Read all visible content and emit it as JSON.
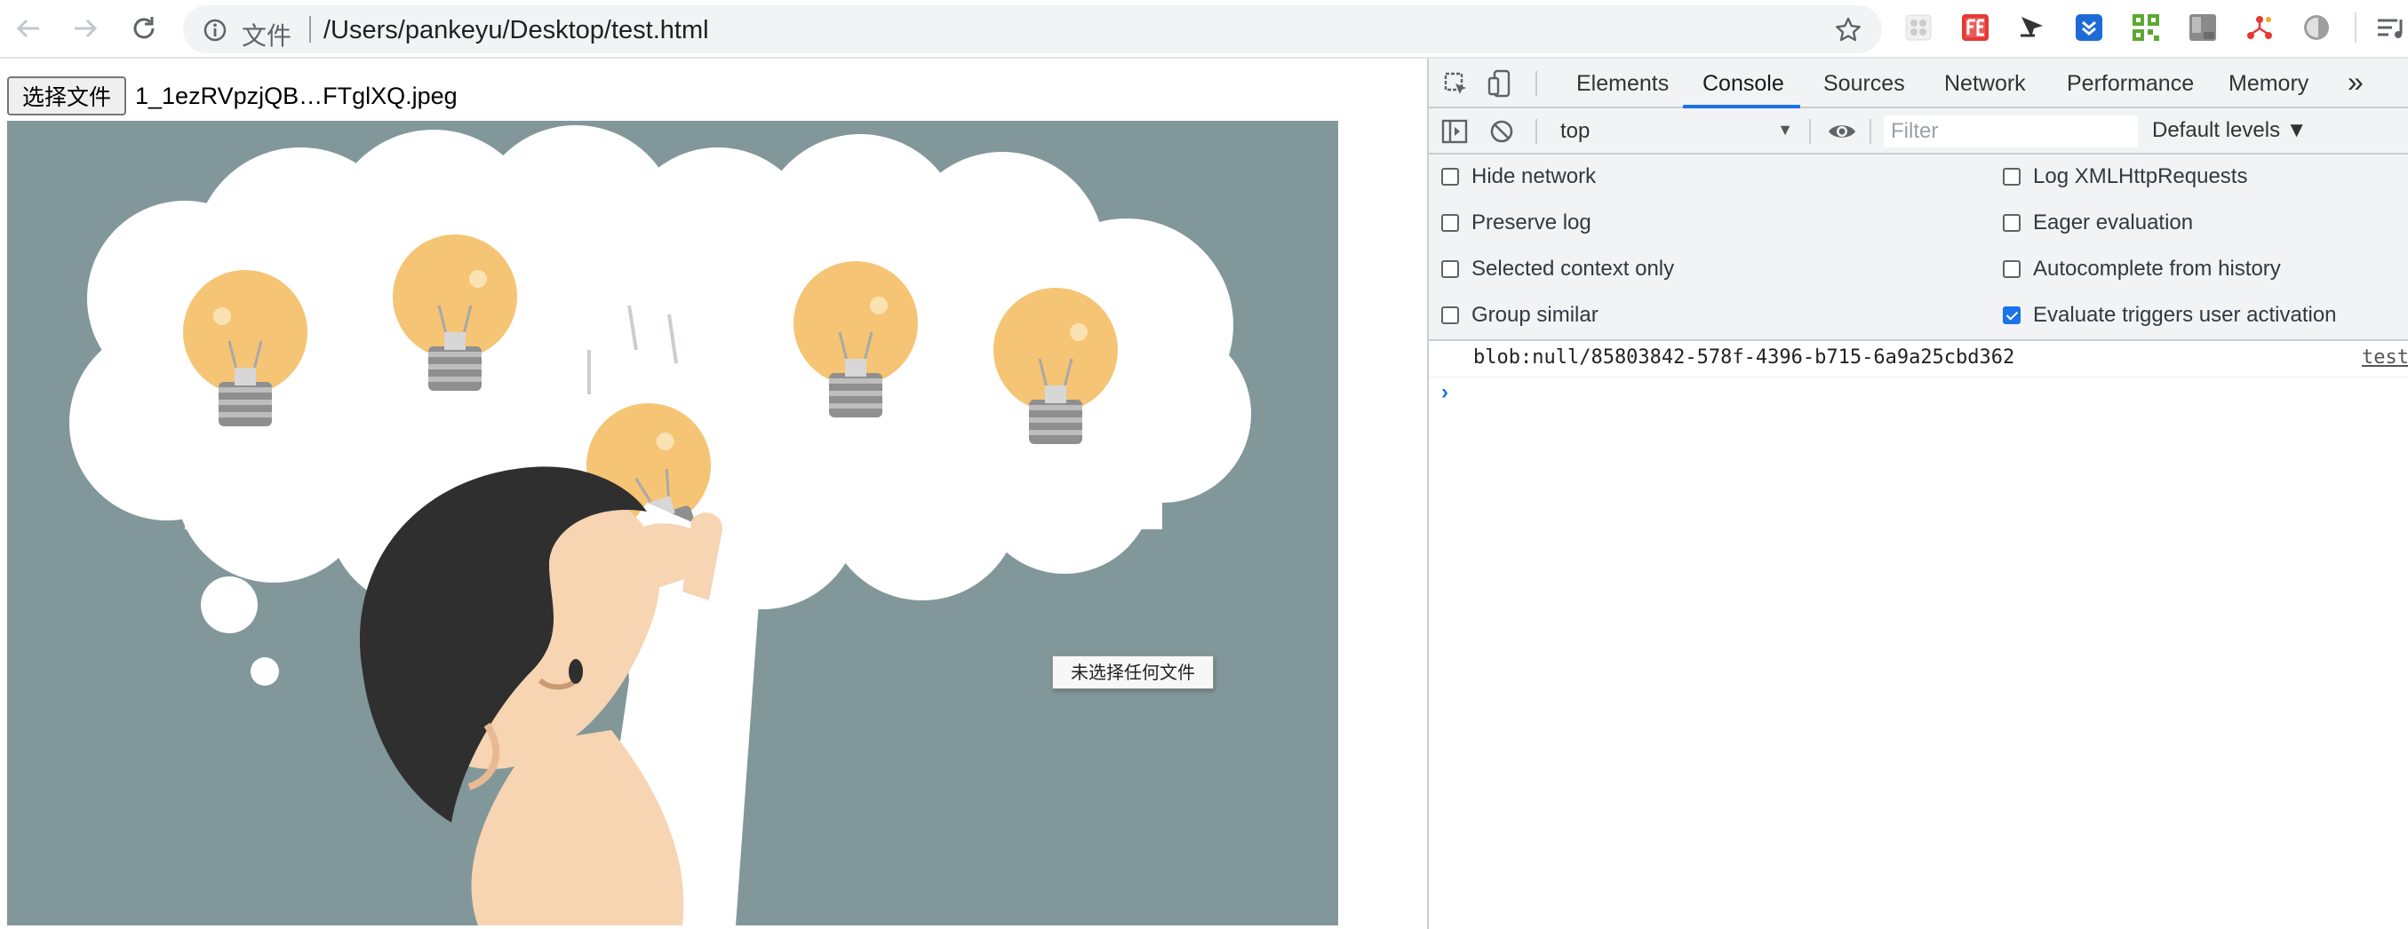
{
  "browser": {
    "file_label": "文件",
    "url": "/Users/pankeyu/Desktop/test.html"
  },
  "page": {
    "choose_button_label": "选择文件",
    "chosen_file_name": "1_1ezRVpzjQB…FTglXQ.jpeg",
    "tooltip": "未选择任何文件"
  },
  "devtools": {
    "tabs": [
      "Elements",
      "Console",
      "Sources",
      "Network",
      "Performance",
      "Memory"
    ],
    "more_tabs_glyph": "»",
    "active_tab": "Console",
    "context": "top",
    "filter_placeholder": "Filter",
    "levels_label": "Default levels ▼",
    "settings_left": [
      {
        "label": "Hide network",
        "checked": false
      },
      {
        "label": "Preserve log",
        "checked": false
      },
      {
        "label": "Selected context only",
        "checked": false
      },
      {
        "label": "Group similar",
        "checked": false
      }
    ],
    "settings_right": [
      {
        "label": "Log XMLHttpRequests",
        "checked": false
      },
      {
        "label": "Eager evaluation",
        "checked": false
      },
      {
        "label": "Autocomplete from history",
        "checked": false
      },
      {
        "label": "Evaluate triggers user activation",
        "checked": true
      }
    ],
    "console_message": "blob:null/85803842-578f-4396-b715-6a9a25cbd362",
    "console_source": "test",
    "prompt_glyph": "›"
  },
  "colors": {
    "accent": "#1a73e8",
    "illustration_bg": "#82979a",
    "bulb": "#f5c474"
  }
}
